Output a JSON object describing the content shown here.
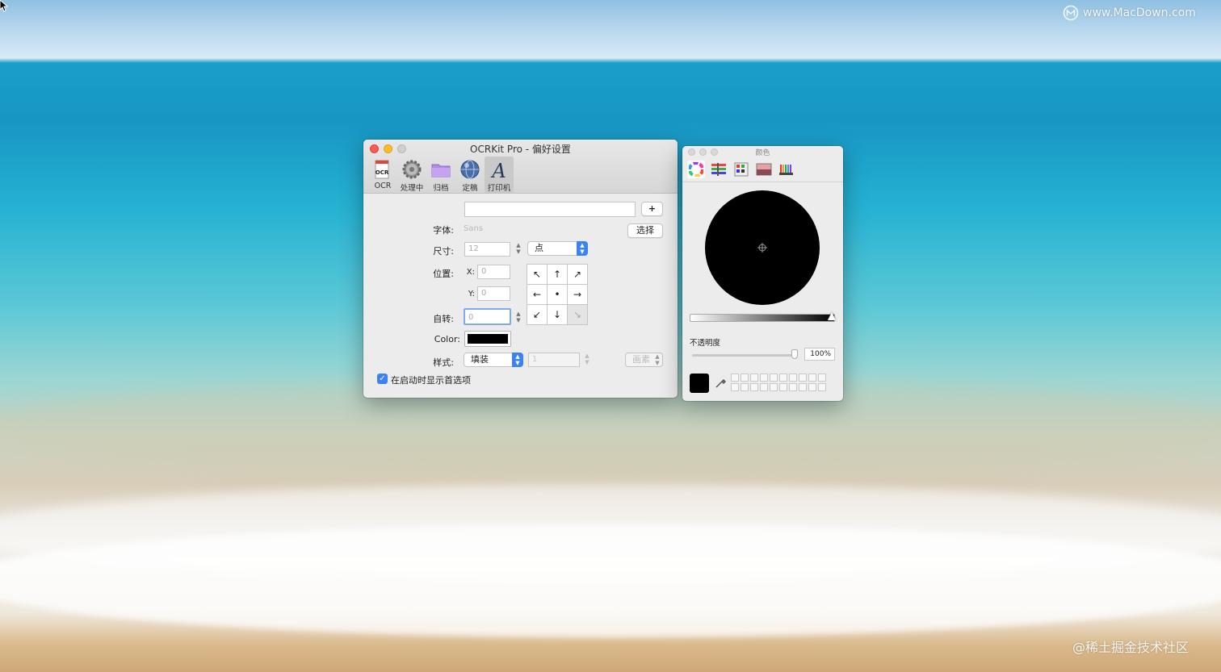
{
  "desktop": {
    "watermark_top": "www.MacDown.com",
    "watermark_bottom": "@稀土掘金技术社区"
  },
  "prefs": {
    "title": "OCRKit Pro - 偏好设置",
    "toolbar": [
      {
        "label": "OCR",
        "icon": "ocr-document-icon"
      },
      {
        "label": "处理中",
        "icon": "gear-icon"
      },
      {
        "label": "归档",
        "icon": "folder-icon"
      },
      {
        "label": "定稿",
        "icon": "globe-icon"
      },
      {
        "label": "打印机",
        "icon": "font-a-icon"
      }
    ],
    "add_button": "+",
    "font_label": "字体:",
    "font_value": "Sans",
    "choose_button": "选择",
    "size_label": "尺寸:",
    "size_value": "12",
    "size_unit": "点",
    "position_label": "位置:",
    "x_label": "X:",
    "x_value": "0",
    "y_label": "Y:",
    "y_value": "0",
    "rotation_label": "自转:",
    "rotation_value": "0",
    "color_label": "Color:",
    "color_value": "#000000",
    "style_label": "样式:",
    "style_value": "填装",
    "stroke_value": "1",
    "stroke_unit": "画素",
    "arrows": [
      "↖",
      "↑",
      "↗",
      "←",
      "•",
      "→",
      "↙",
      "↓",
      "↘"
    ],
    "startup_checkbox_label": "在启动时显示首选项",
    "startup_checked": true
  },
  "colors": {
    "title": "颜色",
    "tabs": [
      "color-wheel-icon",
      "color-sliders-icon",
      "color-palettes-icon",
      "image-palettes-icon",
      "crayons-icon"
    ],
    "selected_color": "#000000",
    "opacity_label": "不透明度",
    "opacity_value": "100%",
    "opacity": 1.0
  }
}
